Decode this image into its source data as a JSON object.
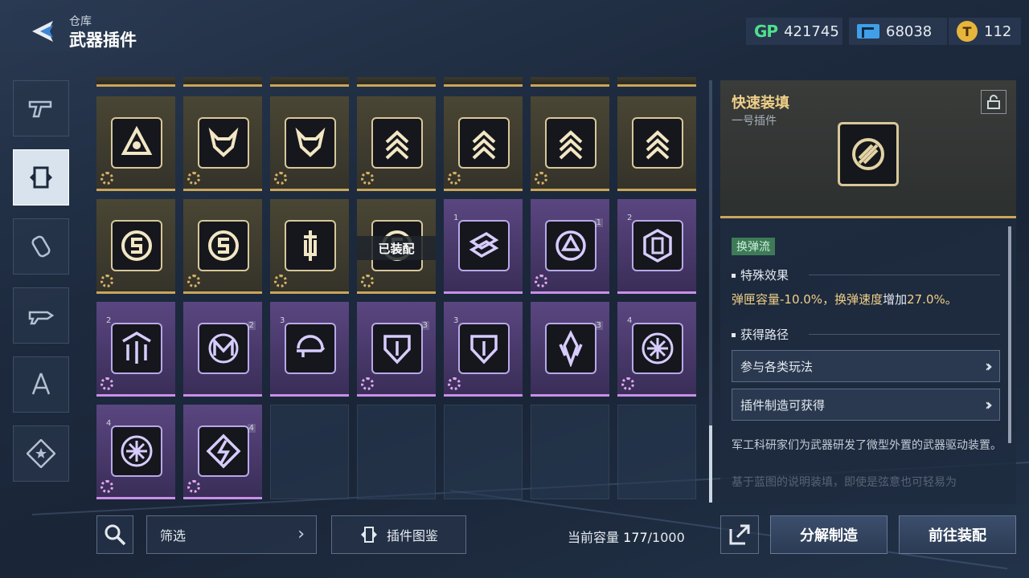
{
  "header": {
    "breadcrumb": "仓库",
    "title": "武器插件",
    "currencies": [
      {
        "icon": "gp-icon",
        "label": "GP",
        "value": "421745"
      },
      {
        "icon": "ticket-icon",
        "value": "68038"
      },
      {
        "icon": "gold-coin-icon",
        "label": "T",
        "value": "112"
      }
    ]
  },
  "sidebar": {
    "items": [
      {
        "icon": "pistol-icon",
        "active": false
      },
      {
        "icon": "plugin-frame-icon",
        "active": true
      },
      {
        "icon": "grenade-icon",
        "active": false
      },
      {
        "icon": "weapon-mod-icon",
        "active": false
      },
      {
        "icon": "compass-tool-icon",
        "active": false
      },
      {
        "icon": "star-badge-icon",
        "active": false
      }
    ]
  },
  "grid": {
    "equipped_label": "已装配",
    "cells": [
      {
        "rarity": "gold",
        "icon": "triangle-target-icon",
        "gear": true
      },
      {
        "rarity": "gold",
        "icon": "dragon-icon",
        "gear": true
      },
      {
        "rarity": "gold",
        "icon": "dragon-icon",
        "gear": true
      },
      {
        "rarity": "gold",
        "icon": "chevrons-up-icon",
        "gear": true
      },
      {
        "rarity": "gold",
        "icon": "chevrons-up-icon",
        "gear": true
      },
      {
        "rarity": "gold",
        "icon": "chevrons-up-icon",
        "gear": true
      },
      {
        "rarity": "gold",
        "icon": "chevrons-up-icon",
        "gear": false
      },
      {
        "rarity": "gold",
        "icon": "s-emblem-icon",
        "gear": true
      },
      {
        "rarity": "gold",
        "icon": "s-emblem-icon",
        "gear": true
      },
      {
        "rarity": "gold",
        "icon": "syringe-icon",
        "gear": true
      },
      {
        "rarity": "gold",
        "icon": "s-emblem-icon",
        "gear": true,
        "equipped": true
      },
      {
        "rarity": "purple",
        "icon": "armor-plates-icon",
        "gear": false,
        "rank": "1"
      },
      {
        "rarity": "purple",
        "icon": "warning-cycle-icon",
        "gear": true,
        "rank": "1"
      },
      {
        "rarity": "purple",
        "icon": "hex-barrel-icon",
        "gear": false,
        "rank": "2"
      },
      {
        "rarity": "purple",
        "icon": "spike-down-icon",
        "gear": true,
        "rank": "2"
      },
      {
        "rarity": "purple",
        "icon": "wave-m-icon",
        "gear": false,
        "rank": "2"
      },
      {
        "rarity": "purple",
        "icon": "rifle-cycle-icon",
        "gear": false,
        "rank": "3"
      },
      {
        "rarity": "purple",
        "icon": "shield-drop-icon",
        "gear": true,
        "rank": "3"
      },
      {
        "rarity": "purple",
        "icon": "shield-drop-icon",
        "gear": true,
        "rank": "3"
      },
      {
        "rarity": "purple",
        "icon": "crystal-icon",
        "gear": false,
        "rank": "3"
      },
      {
        "rarity": "purple",
        "icon": "flower-circle-icon",
        "gear": true,
        "rank": "4"
      },
      {
        "rarity": "purple",
        "icon": "flower-circle-icon",
        "gear": true,
        "rank": "4"
      },
      {
        "rarity": "purple",
        "icon": "lightning-diamond-icon",
        "gear": true,
        "rank": "4"
      }
    ]
  },
  "bottom": {
    "filter_label": "筛选",
    "codex_label": "插件图鉴",
    "capacity_label": "当前容量",
    "capacity_current": "177",
    "capacity_max": "/1000"
  },
  "detail": {
    "name": "快速装填",
    "subtitle": "一号插件",
    "tag": "换弹流",
    "effect_title": "特殊效果",
    "effect_part1": "弹匣容量-10.0%，换弹速度",
    "effect_word": "增加",
    "effect_part2": "27.0%。",
    "route_title": "获得路径",
    "routes": [
      "参与各类玩法",
      "插件制造可获得"
    ],
    "description": "军工科研家们为武器研发了微型外置的武器驱动装置。",
    "description_faded": "基于蓝图的说明装填，即使是弦意也可轻易为"
  },
  "actions": {
    "salvage_label": "分解制造",
    "equip_label": "前往装配"
  },
  "colors": {
    "gold_accent": "#c9a65a",
    "purple_accent": "#c890e8",
    "gp_green": "#4fe08a",
    "highlight_text": "#f0d088"
  }
}
